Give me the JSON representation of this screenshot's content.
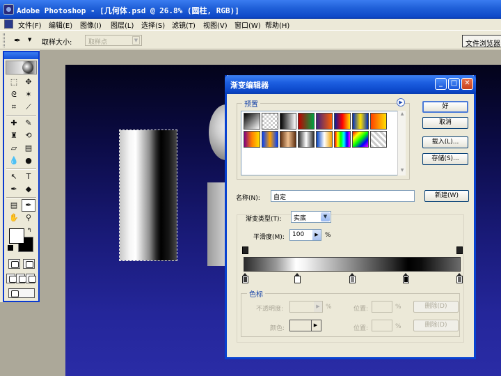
{
  "window": {
    "title": "Adobe Photoshop - [几何体.psd @ 26.8% (圆柱, RGB)]"
  },
  "menu": [
    {
      "label": "文件(F)"
    },
    {
      "label": "编辑(E)"
    },
    {
      "label": "图像(I)"
    },
    {
      "label": "图层(L)"
    },
    {
      "label": "选择(S)"
    },
    {
      "label": "滤镜(T)"
    },
    {
      "label": "视图(V)"
    },
    {
      "label": "窗口(W)"
    },
    {
      "label": "帮助(H)"
    }
  ],
  "options_bar": {
    "sample_size_label": "取样大小:",
    "sample_size_value": "取样点",
    "file_browser_button": "文件浏览器"
  },
  "dialog": {
    "title": "渐变编辑器",
    "presets_legend": "预置",
    "ok_button": "好",
    "cancel_button": "取消",
    "load_button": "载入(L)...",
    "save_button": "存储(S)...",
    "name_label": "名称(N):",
    "name_value": "自定",
    "new_button": "新建(W)",
    "gradient_type_label": "渐变类型(T):",
    "gradient_type_value": "实底",
    "smoothness_label": "平滑度(M):",
    "smoothness_value": "100",
    "smoothness_unit": "%",
    "stops_legend": "色标",
    "opacity_label": "不透明度:",
    "opacity_unit": "%",
    "location_label": "位置:",
    "location_unit": "%",
    "delete_label": "删除(D)",
    "color_label": "颜色:",
    "color_location_label": "位置:",
    "color_location_unit": "%",
    "color_delete_label": "删除(D)"
  },
  "colors": {
    "titlebar": "#1f5fd8",
    "foreground": "#ffffff",
    "background": "#000000"
  }
}
